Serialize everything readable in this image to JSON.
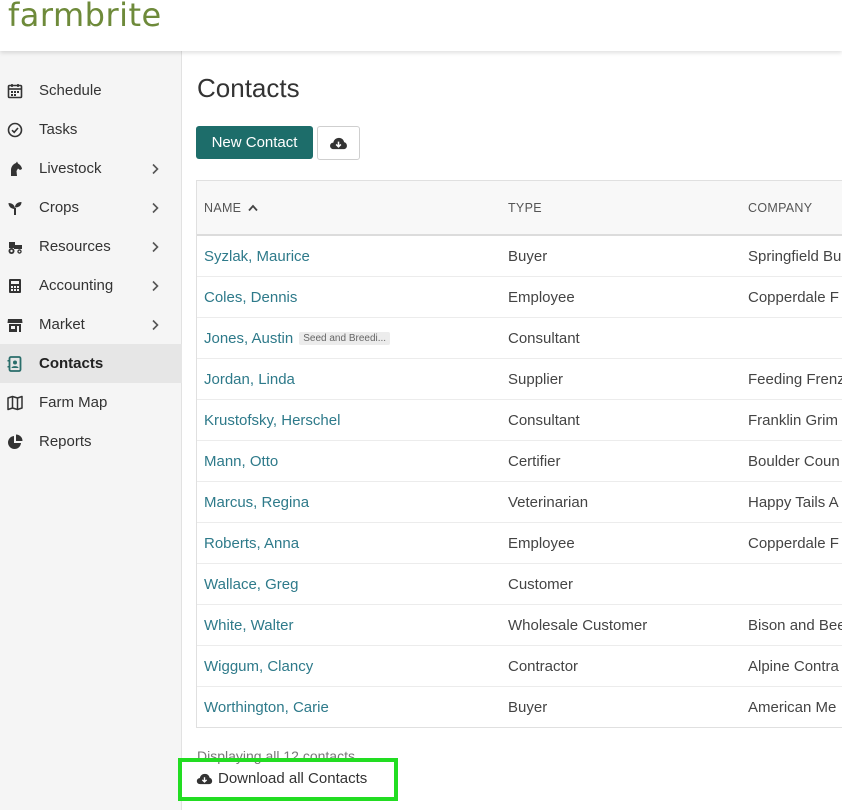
{
  "app": {
    "logo": "farmbrite"
  },
  "sidebar": {
    "items": [
      {
        "label": "Schedule",
        "icon": "calendar-icon",
        "has_submenu": false,
        "active": false
      },
      {
        "label": "Tasks",
        "icon": "check-circle-icon",
        "has_submenu": false,
        "active": false
      },
      {
        "label": "Livestock",
        "icon": "horse-icon",
        "has_submenu": true,
        "active": false
      },
      {
        "label": "Crops",
        "icon": "seedling-icon",
        "has_submenu": true,
        "active": false
      },
      {
        "label": "Resources",
        "icon": "tractor-icon",
        "has_submenu": true,
        "active": false
      },
      {
        "label": "Accounting",
        "icon": "calculator-icon",
        "has_submenu": true,
        "active": false
      },
      {
        "label": "Market",
        "icon": "store-icon",
        "has_submenu": true,
        "active": false
      },
      {
        "label": "Contacts",
        "icon": "address-book-icon",
        "has_submenu": false,
        "active": true
      },
      {
        "label": "Farm Map",
        "icon": "map-icon",
        "has_submenu": false,
        "active": false
      },
      {
        "label": "Reports",
        "icon": "pie-chart-icon",
        "has_submenu": false,
        "active": false
      }
    ]
  },
  "main": {
    "title": "Contacts",
    "new_contact_label": "New Contact",
    "cloud_button_icon": "cloud-download-icon"
  },
  "table": {
    "columns": {
      "name": "NAME",
      "type": "TYPE",
      "company": "COMPANY"
    },
    "sort_indicator": "ascending",
    "rows": [
      {
        "name": "Syzlak, Maurice",
        "tag": "",
        "type": "Buyer",
        "company": "Springfield Bu"
      },
      {
        "name": "Coles, Dennis",
        "tag": "",
        "type": "Employee",
        "company": "Copperdale F"
      },
      {
        "name": "Jones, Austin",
        "tag": "Seed and Breedi...",
        "type": "Consultant",
        "company": ""
      },
      {
        "name": "Jordan, Linda",
        "tag": "",
        "type": "Supplier",
        "company": "Feeding Frenz"
      },
      {
        "name": "Krustofsky, Herschel",
        "tag": "",
        "type": "Consultant",
        "company": "Franklin Grim"
      },
      {
        "name": "Mann, Otto",
        "tag": "",
        "type": "Certifier",
        "company": "Boulder Coun"
      },
      {
        "name": "Marcus, Regina",
        "tag": "",
        "type": "Veterinarian",
        "company": "Happy Tails A"
      },
      {
        "name": "Roberts, Anna",
        "tag": "",
        "type": "Employee",
        "company": "Copperdale F"
      },
      {
        "name": "Wallace, Greg",
        "tag": "",
        "type": "Customer",
        "company": ""
      },
      {
        "name": "White, Walter",
        "tag": "",
        "type": "Wholesale Customer",
        "company": "Bison and Bee"
      },
      {
        "name": "Wiggum, Clancy",
        "tag": "",
        "type": "Contractor",
        "company": "Alpine Contra"
      },
      {
        "name": "Worthington, Carie",
        "tag": "",
        "type": "Buyer",
        "company": "American Me"
      }
    ]
  },
  "footer": {
    "count_text": "Displaying all 12 contacts",
    "download_label": "Download all Contacts"
  },
  "colors": {
    "brand_green": "#6e8a3a",
    "primary_button": "#1d6d6a",
    "link": "#2e7a8a",
    "highlight": "#22dd22"
  }
}
